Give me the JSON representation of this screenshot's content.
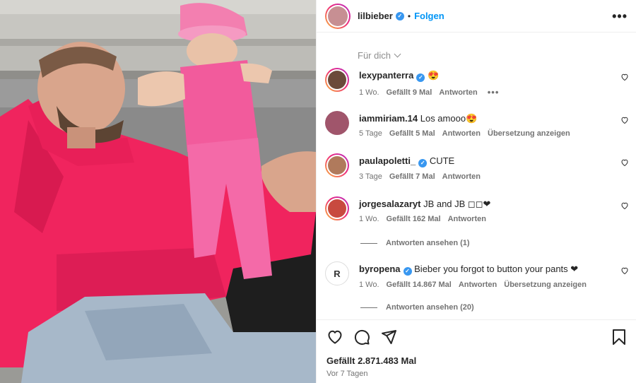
{
  "post": {
    "author": "lilbieber",
    "verified": true,
    "separator": "•",
    "follow_label": "Folgen",
    "more_label": "•••"
  },
  "sort_label": "Für dich",
  "comments": [
    {
      "user": "lexypanterra",
      "verified": true,
      "text": "😍",
      "time": "1 Wo.",
      "likes": "Gefällt 9 Mal",
      "reply": "Antworten",
      "translate": "",
      "extra": "•••"
    },
    {
      "user": "iammiriam.14",
      "verified": false,
      "text": "Los amooo😍",
      "time": "5 Tage",
      "likes": "Gefällt 5 Mal",
      "reply": "Antworten",
      "translate": "Übersetzung anzeigen"
    },
    {
      "user": "paulapoletti_",
      "verified": true,
      "text": "CUTE",
      "time": "3 Tage",
      "likes": "Gefällt 7 Mal",
      "reply": "Antworten",
      "translate": ""
    },
    {
      "user": "jorgesalazaryt",
      "verified": false,
      "text": "JB and JB ◻◻❤",
      "time": "1 Wo.",
      "likes": "Gefällt 162 Mal",
      "reply": "Antworten",
      "translate": ""
    },
    {
      "user": "byropena",
      "verified": true,
      "text": "Bieber you forgot to button your pants ❤",
      "time": "1 Wo.",
      "likes": "Gefällt 14.867 Mal",
      "reply": "Antworten",
      "translate": "Übersetzung anzeigen"
    }
  ],
  "view_replies": [
    "Antworten ansehen (1)",
    "Antworten ansehen (20)"
  ],
  "footer": {
    "likes": "Gefällt 2.871.483 Mal",
    "time_ago": "Vor 7 Tagen"
  },
  "icons": {
    "like": "heart-icon",
    "comment": "comment-icon",
    "share": "share-icon",
    "save": "bookmark-icon"
  },
  "colors": {
    "follow": "#0095f6",
    "verified": "#3897f0",
    "hoodie": "#f0245e",
    "baby_outfit": "#f25b9c"
  }
}
